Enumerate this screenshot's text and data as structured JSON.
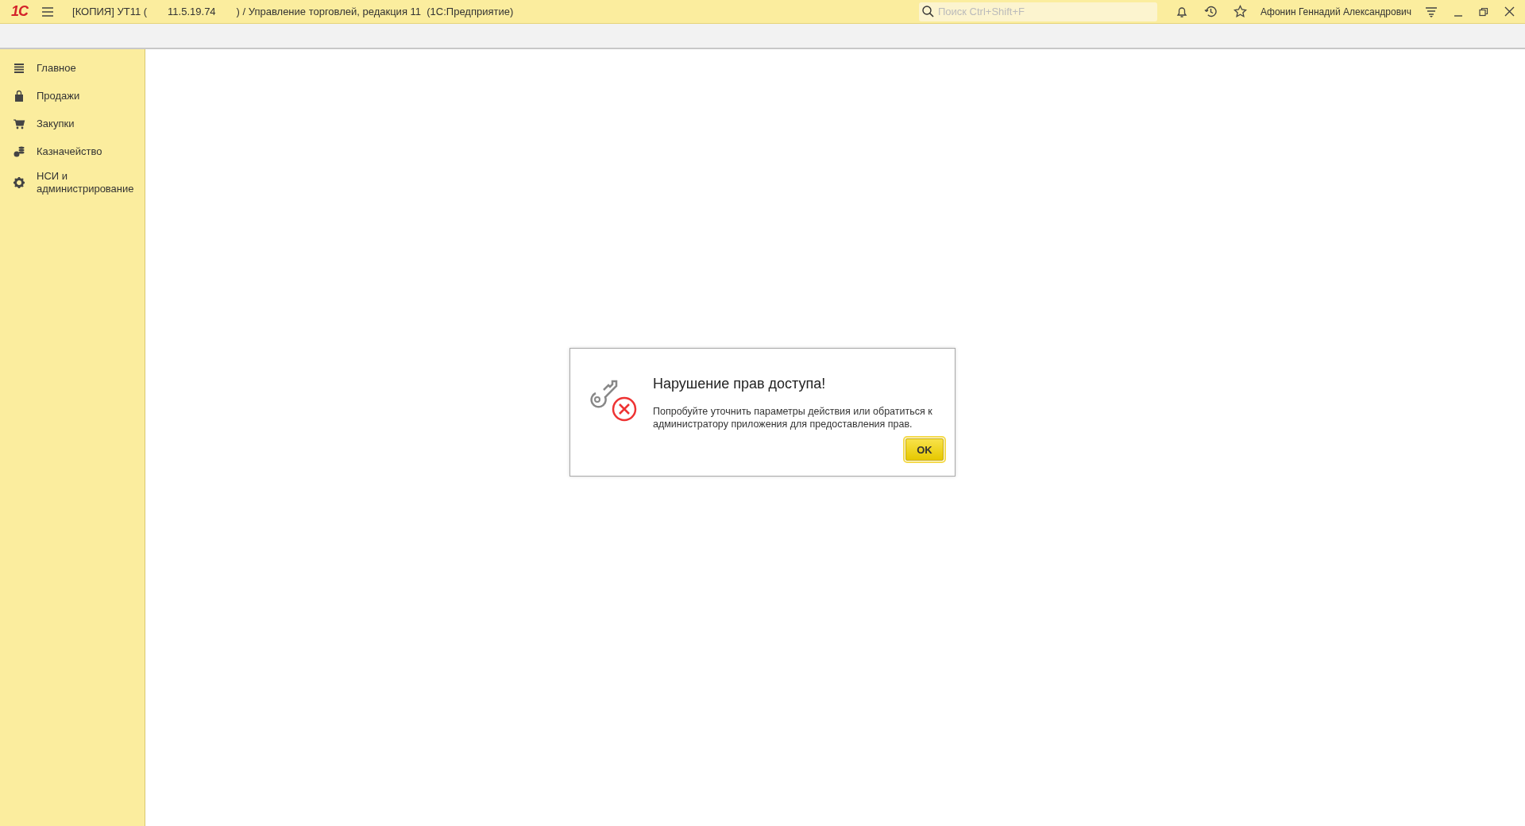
{
  "title_bar": {
    "logo": "1С",
    "title_parts": [
      "[КОПИЯ] УТ11 (",
      "11.5.19.74",
      ") / Управление торговлей, редакция 11  (1С:Предприятие)"
    ],
    "search": {
      "placeholder": "Поиск Ctrl+Shift+F"
    },
    "user": "Афонин Геннадий Александрович"
  },
  "sidebar": {
    "items": [
      {
        "label": "Главное",
        "kind": "menu"
      },
      {
        "label": "Продажи",
        "kind": "bag"
      },
      {
        "label": "Закупки",
        "kind": "cart"
      },
      {
        "label": "Казначейство",
        "kind": "coins"
      },
      {
        "label": "НСИ и администрирование",
        "kind": "gear"
      }
    ]
  },
  "dialog": {
    "title": "Нарушение прав доступа!",
    "message": "Попробуйте уточнить параметры действия или обратиться к администратору приложения для предоставления прав.",
    "buttons": [
      "OK"
    ]
  }
}
